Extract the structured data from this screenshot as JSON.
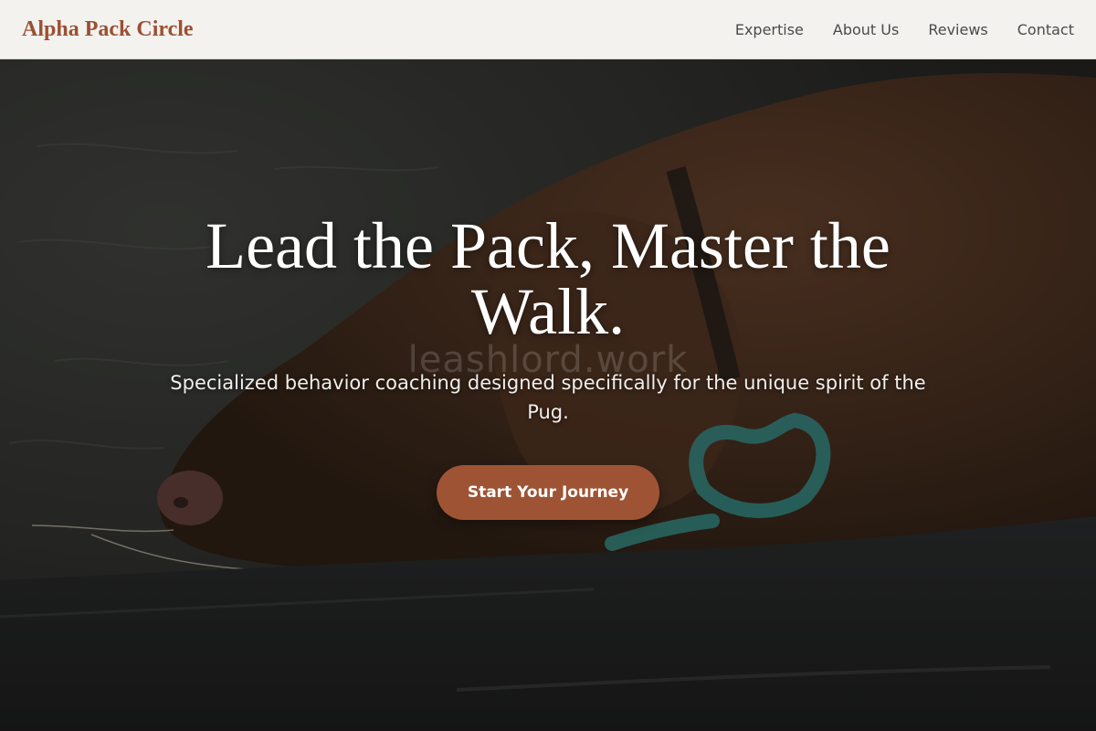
{
  "header": {
    "brand": "Alpha Pack Circle",
    "nav": [
      "Expertise",
      "About Us",
      "Reviews",
      "Contact"
    ]
  },
  "hero": {
    "title": "Lead the Pack, Master the Walk.",
    "watermark": "leashlord.work",
    "subtitle": "Specialized behavior coaching designed specifically for the unique spirit of the Pug.",
    "cta_label": "Start Your Journey"
  },
  "colors": {
    "brand": "#9b5032",
    "cta": "#9e5434",
    "header_bg": "#f3f2ef"
  }
}
